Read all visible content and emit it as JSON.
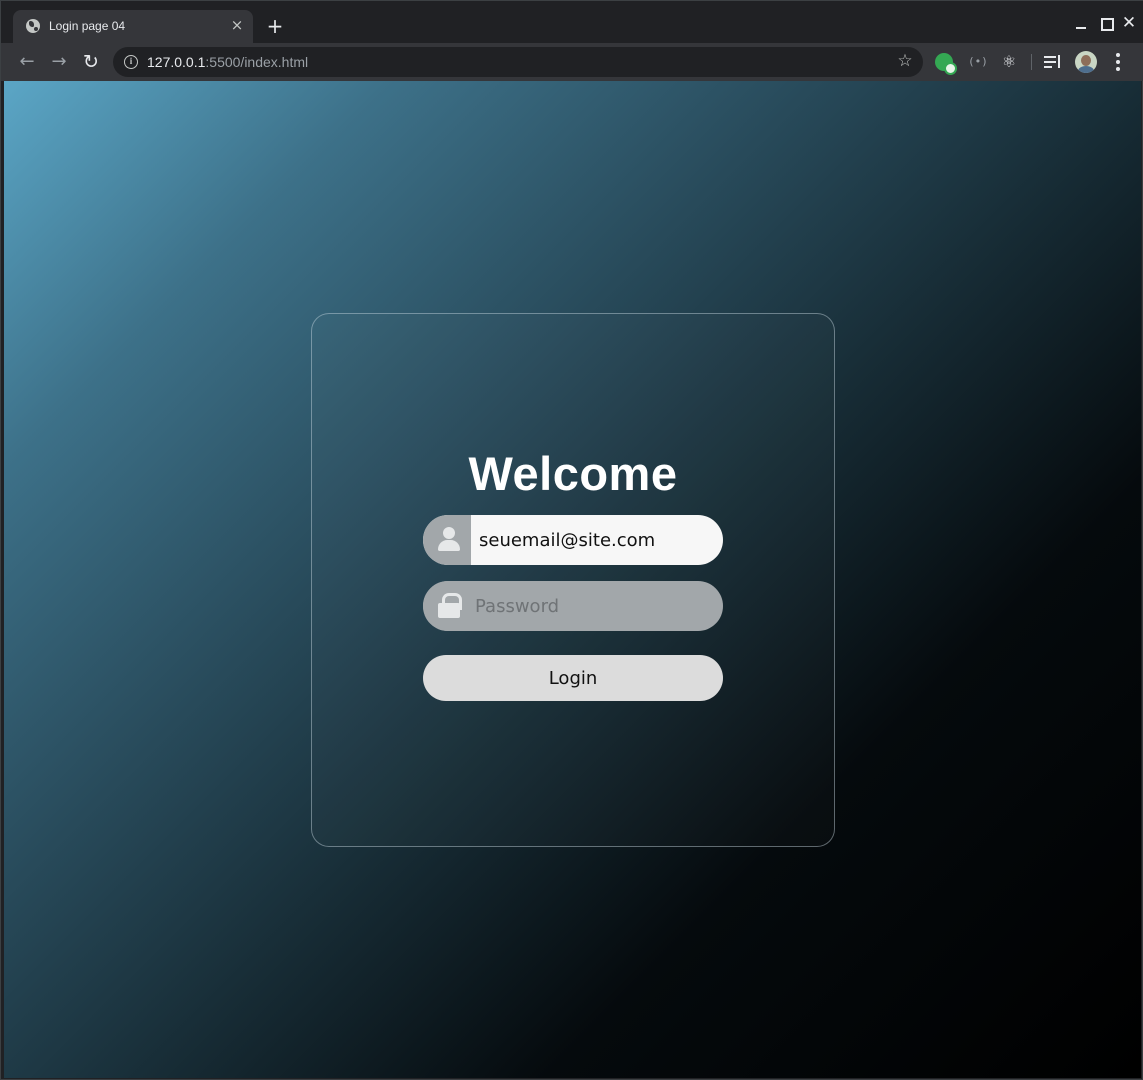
{
  "browser": {
    "tab_title": "Login page 04",
    "tab_close": "×",
    "new_tab": "+",
    "url_host": "127.0.0.1",
    "url_rest": ":5500/index.html",
    "win_close": "✕",
    "icons": {
      "back": "←",
      "forward": "→",
      "reload": "↻",
      "info": "i",
      "star": "☆",
      "ext_broadcast": "(•)",
      "ext_react": "⚛"
    }
  },
  "login": {
    "heading": "Welcome",
    "email_value": "seuemail@site.com",
    "password_placeholder": "Password",
    "submit_label": "Login"
  },
  "colors": {
    "gradient_start": "#5ba6c6",
    "gradient_end": "#000000",
    "email_field_bg": "#f7f7f7",
    "password_field_bg": "#a2a7aa",
    "button_bg": "#dcdcdc"
  }
}
